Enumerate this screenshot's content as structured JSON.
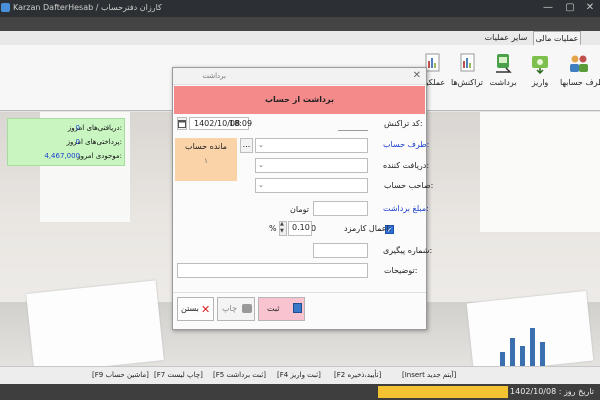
{
  "window": {
    "title": "Karzan DafterHesab / کارزان دفترحساب",
    "controls": {
      "minimize": "—",
      "maximize": "▢",
      "close": "✕"
    }
  },
  "ribbon": {
    "tabs": {
      "financial": "عملیات مالی",
      "other": "سایر عملیات"
    },
    "buttons": [
      {
        "label": "طرف حسابها",
        "icon": "people-icon"
      },
      {
        "label": "واریز",
        "icon": "deposit-icon"
      },
      {
        "label": "برداشت",
        "icon": "withdraw-icon"
      },
      {
        "label": "تراکنش‌ها",
        "icon": "transactions-icon"
      },
      {
        "label": "عملکرد",
        "icon": "report-icon"
      }
    ]
  },
  "info_panel": {
    "rows": [
      {
        "label": "دریافتی‌های امروز:",
        "value": "0"
      },
      {
        "label": "پرداختی‌های امروز:",
        "value": "0"
      },
      {
        "label": "موجودی امروز:",
        "value": "4,467,000"
      }
    ]
  },
  "dialog": {
    "window_title": "برداشت",
    "header": "برداشت از حساب",
    "fields": {
      "transaction_code_label": "کد تراکنش:",
      "account_label": "طرف حساب:",
      "receiver_label": "دریافت کننده:",
      "owner_label": "صاحب حساب:",
      "amount_label": "مبلغ برداشت:",
      "amount_unit": "تومان",
      "fee_label": "اعمال کارمزد:",
      "fee_amount": "0",
      "fee_percent": "0.10",
      "percent_sign": "%",
      "tracking_label": "شماره پیگیری:",
      "description_label": "توضیحات:",
      "date": "1402/10/08",
      "time": "18:09",
      "dots": "..."
    },
    "balance": {
      "title": "مانده حساب",
      "value": "۱"
    },
    "buttons": {
      "save": "ثبت",
      "print": "چاپ",
      "close": "بستن"
    }
  },
  "shortcuts": [
    "[Insert آیتم جدید]",
    "[F2 تأیید،ذخیره]",
    "[F4 ثبت واریز]",
    "[F5 ثبت برداشت]",
    "[F7 چاپ لیست]",
    "[F9 ماشین حساب]"
  ],
  "status": {
    "date": "تاریخ روز : 1402/10/08"
  }
}
